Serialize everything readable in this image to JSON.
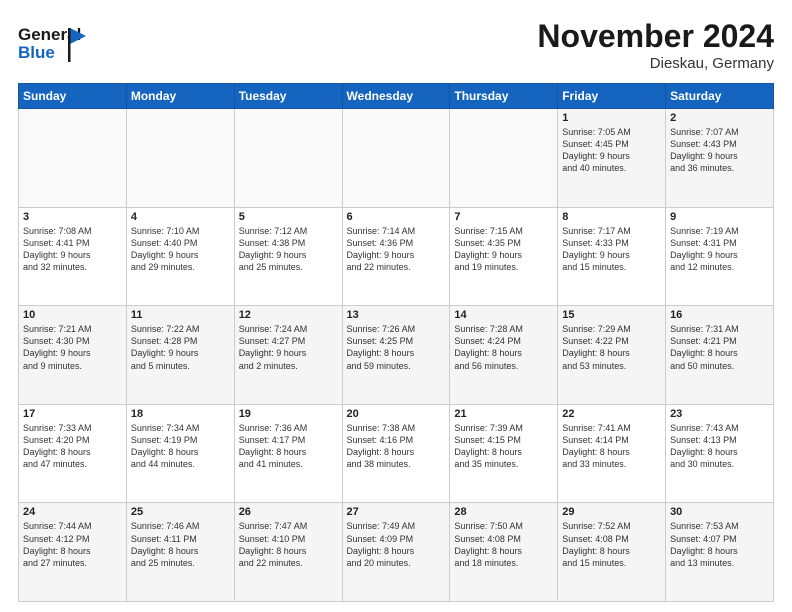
{
  "header": {
    "logo_line1": "General",
    "logo_line2": "Blue",
    "month": "November 2024",
    "location": "Dieskau, Germany"
  },
  "weekdays": [
    "Sunday",
    "Monday",
    "Tuesday",
    "Wednesday",
    "Thursday",
    "Friday",
    "Saturday"
  ],
  "weeks": [
    [
      {
        "day": "",
        "info": ""
      },
      {
        "day": "",
        "info": ""
      },
      {
        "day": "",
        "info": ""
      },
      {
        "day": "",
        "info": ""
      },
      {
        "day": "",
        "info": ""
      },
      {
        "day": "1",
        "info": "Sunrise: 7:05 AM\nSunset: 4:45 PM\nDaylight: 9 hours\nand 40 minutes."
      },
      {
        "day": "2",
        "info": "Sunrise: 7:07 AM\nSunset: 4:43 PM\nDaylight: 9 hours\nand 36 minutes."
      }
    ],
    [
      {
        "day": "3",
        "info": "Sunrise: 7:08 AM\nSunset: 4:41 PM\nDaylight: 9 hours\nand 32 minutes."
      },
      {
        "day": "4",
        "info": "Sunrise: 7:10 AM\nSunset: 4:40 PM\nDaylight: 9 hours\nand 29 minutes."
      },
      {
        "day": "5",
        "info": "Sunrise: 7:12 AM\nSunset: 4:38 PM\nDaylight: 9 hours\nand 25 minutes."
      },
      {
        "day": "6",
        "info": "Sunrise: 7:14 AM\nSunset: 4:36 PM\nDaylight: 9 hours\nand 22 minutes."
      },
      {
        "day": "7",
        "info": "Sunrise: 7:15 AM\nSunset: 4:35 PM\nDaylight: 9 hours\nand 19 minutes."
      },
      {
        "day": "8",
        "info": "Sunrise: 7:17 AM\nSunset: 4:33 PM\nDaylight: 9 hours\nand 15 minutes."
      },
      {
        "day": "9",
        "info": "Sunrise: 7:19 AM\nSunset: 4:31 PM\nDaylight: 9 hours\nand 12 minutes."
      }
    ],
    [
      {
        "day": "10",
        "info": "Sunrise: 7:21 AM\nSunset: 4:30 PM\nDaylight: 9 hours\nand 9 minutes."
      },
      {
        "day": "11",
        "info": "Sunrise: 7:22 AM\nSunset: 4:28 PM\nDaylight: 9 hours\nand 5 minutes."
      },
      {
        "day": "12",
        "info": "Sunrise: 7:24 AM\nSunset: 4:27 PM\nDaylight: 9 hours\nand 2 minutes."
      },
      {
        "day": "13",
        "info": "Sunrise: 7:26 AM\nSunset: 4:25 PM\nDaylight: 8 hours\nand 59 minutes."
      },
      {
        "day": "14",
        "info": "Sunrise: 7:28 AM\nSunset: 4:24 PM\nDaylight: 8 hours\nand 56 minutes."
      },
      {
        "day": "15",
        "info": "Sunrise: 7:29 AM\nSunset: 4:22 PM\nDaylight: 8 hours\nand 53 minutes."
      },
      {
        "day": "16",
        "info": "Sunrise: 7:31 AM\nSunset: 4:21 PM\nDaylight: 8 hours\nand 50 minutes."
      }
    ],
    [
      {
        "day": "17",
        "info": "Sunrise: 7:33 AM\nSunset: 4:20 PM\nDaylight: 8 hours\nand 47 minutes."
      },
      {
        "day": "18",
        "info": "Sunrise: 7:34 AM\nSunset: 4:19 PM\nDaylight: 8 hours\nand 44 minutes."
      },
      {
        "day": "19",
        "info": "Sunrise: 7:36 AM\nSunset: 4:17 PM\nDaylight: 8 hours\nand 41 minutes."
      },
      {
        "day": "20",
        "info": "Sunrise: 7:38 AM\nSunset: 4:16 PM\nDaylight: 8 hours\nand 38 minutes."
      },
      {
        "day": "21",
        "info": "Sunrise: 7:39 AM\nSunset: 4:15 PM\nDaylight: 8 hours\nand 35 minutes."
      },
      {
        "day": "22",
        "info": "Sunrise: 7:41 AM\nSunset: 4:14 PM\nDaylight: 8 hours\nand 33 minutes."
      },
      {
        "day": "23",
        "info": "Sunrise: 7:43 AM\nSunset: 4:13 PM\nDaylight: 8 hours\nand 30 minutes."
      }
    ],
    [
      {
        "day": "24",
        "info": "Sunrise: 7:44 AM\nSunset: 4:12 PM\nDaylight: 8 hours\nand 27 minutes."
      },
      {
        "day": "25",
        "info": "Sunrise: 7:46 AM\nSunset: 4:11 PM\nDaylight: 8 hours\nand 25 minutes."
      },
      {
        "day": "26",
        "info": "Sunrise: 7:47 AM\nSunset: 4:10 PM\nDaylight: 8 hours\nand 22 minutes."
      },
      {
        "day": "27",
        "info": "Sunrise: 7:49 AM\nSunset: 4:09 PM\nDaylight: 8 hours\nand 20 minutes."
      },
      {
        "day": "28",
        "info": "Sunrise: 7:50 AM\nSunset: 4:08 PM\nDaylight: 8 hours\nand 18 minutes."
      },
      {
        "day": "29",
        "info": "Sunrise: 7:52 AM\nSunset: 4:08 PM\nDaylight: 8 hours\nand 15 minutes."
      },
      {
        "day": "30",
        "info": "Sunrise: 7:53 AM\nSunset: 4:07 PM\nDaylight: 8 hours\nand 13 minutes."
      }
    ]
  ]
}
